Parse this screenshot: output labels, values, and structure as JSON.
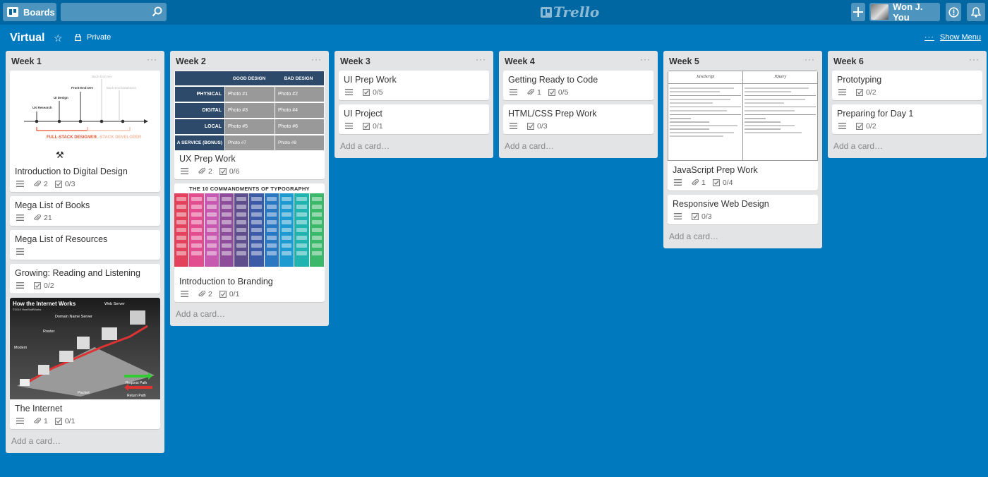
{
  "header": {
    "boards_label": "Boards",
    "logo_text": "Trello",
    "user_name": "Won J. You"
  },
  "board": {
    "title": "Virtual",
    "visibility": "Private",
    "show_menu": "Show Menu"
  },
  "lists": [
    {
      "title": "Week 1",
      "add_card": "Add a card…",
      "cards": [
        {
          "title": "Introduction to Digital Design",
          "attachments": "2",
          "checklist": "0/3"
        },
        {
          "title": "Mega List of Books",
          "attachments": "21"
        },
        {
          "title": "Mega List of Resources"
        },
        {
          "title": "Growing: Reading and Listening",
          "checklist": "0/2"
        },
        {
          "title": "The Internet",
          "attachments": "1",
          "checklist": "0/1"
        }
      ]
    },
    {
      "title": "Week 2",
      "add_card": "Add a card…",
      "cards": [
        {
          "title": "UX Prep Work",
          "attachments": "2",
          "checklist": "0/6"
        },
        {
          "title": "Introduction to Branding",
          "attachments": "2",
          "checklist": "0/1"
        }
      ]
    },
    {
      "title": "Week 3",
      "add_card": "Add a card…",
      "cards": [
        {
          "title": "UI Prep Work",
          "checklist": "0/5"
        },
        {
          "title": "UI Project",
          "checklist": "0/1"
        }
      ]
    },
    {
      "title": "Week 4",
      "add_card": "Add a card…",
      "cards": [
        {
          "title": "Getting Ready to Code",
          "attachments": "1",
          "checklist": "0/5"
        },
        {
          "title": "HTML/CSS Prep Work",
          "checklist": "0/3"
        }
      ]
    },
    {
      "title": "Week 5",
      "add_card": "Add a card…",
      "cards": [
        {
          "title": "JavaScript Prep Work",
          "attachments": "1",
          "checklist": "0/4"
        },
        {
          "title": "Responsive Web Design",
          "checklist": "0/3"
        }
      ]
    },
    {
      "title": "Week 6",
      "add_card": "Add a card…",
      "cards": [
        {
          "title": "Prototyping",
          "checklist": "0/2"
        },
        {
          "title": "Preparing for Day 1",
          "checklist": "0/2"
        }
      ]
    }
  ],
  "covers": {
    "fullstack": {
      "labels": [
        "Back-End Dev",
        "Front-End Dev",
        "UI Design",
        "UX Research",
        "Back-End Databases"
      ],
      "designer": "FULL-STACK DESIGNER",
      "developer": "FULL-STACK DEVELOPER"
    },
    "internet": {
      "title": "How the Internet Works",
      "copyright": "©2010 HowStuffWorks",
      "labels": [
        "Web Server",
        "Domain Name Server",
        "Router",
        "Modem",
        "Packet",
        "Request Path",
        "Return Path"
      ]
    },
    "good_bad": {
      "headers": [
        "GOOD DESIGN",
        "BAD DESIGN"
      ],
      "rows": [
        {
          "label": "PHYSICAL",
          "good": "Photo #1",
          "bad": "Photo #2"
        },
        {
          "label": "DIGITAL",
          "good": "Photo #3",
          "bad": "Photo #4"
        },
        {
          "label": "LOCAL",
          "good": "Photo #5",
          "bad": "Photo #6"
        },
        {
          "label": "A SERVICE (BONUS)",
          "good": "Photo #7",
          "bad": "Photo #8"
        }
      ]
    },
    "typography": {
      "title": "THE 10 COMMANDMENTS OF TYPOGRAPHY",
      "colors": [
        "#e2425b",
        "#e24d8f",
        "#c65ab0",
        "#8e4d9a",
        "#5e4f8c",
        "#3c5aa6",
        "#2a77c2",
        "#1f9ad0",
        "#20b3b0",
        "#3bb86a"
      ]
    },
    "jsquery": {
      "headers": [
        "JavaScript",
        "JQuery"
      ]
    }
  }
}
